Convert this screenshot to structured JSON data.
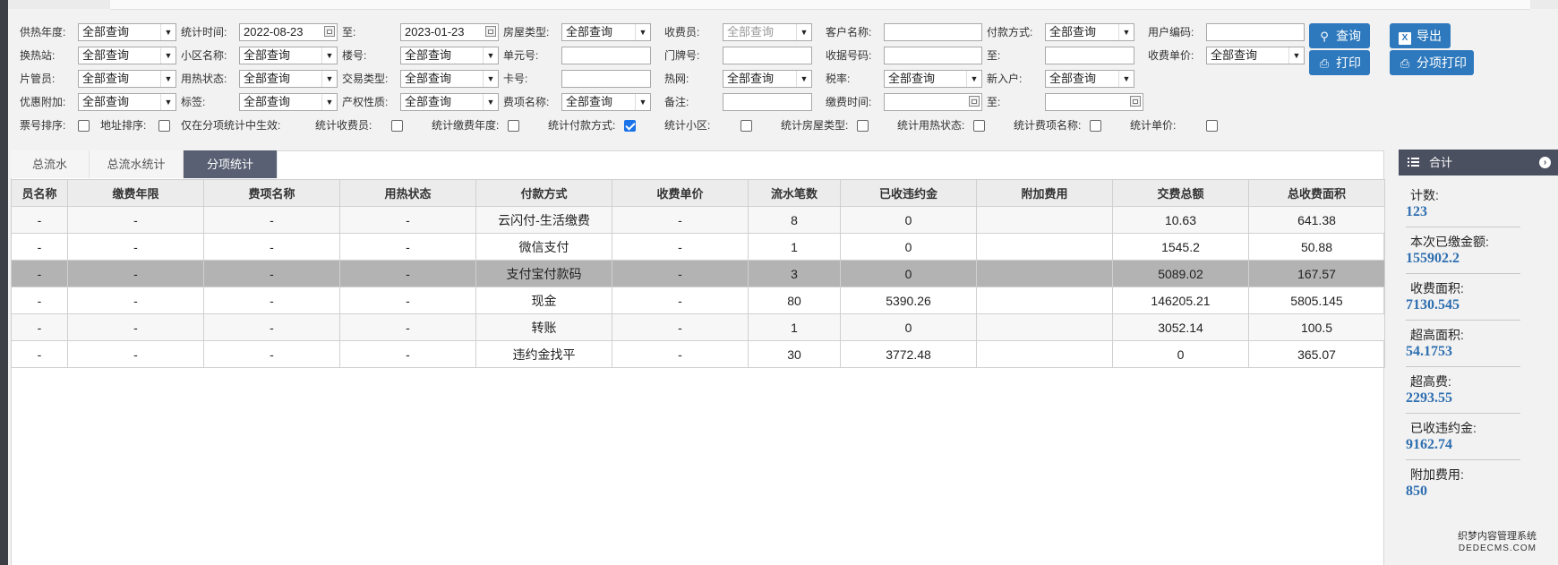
{
  "filters": {
    "row1": {
      "heating_year_label": "供热年度:",
      "heating_year_value": "全部查询",
      "stat_time_label": "统计时间:",
      "stat_time_from": "2022-08-23",
      "to_label": "至:",
      "stat_time_to": "2023-01-23",
      "house_type_label": "房屋类型:",
      "house_type_value": "全部查询",
      "collector_label": "收费员:",
      "collector_value": "全部查询",
      "customer_name_label": "客户名称:",
      "customer_name_value": "",
      "payment_method_label": "付款方式:",
      "payment_method_value": "全部查询",
      "user_code_label": "用户编码:",
      "user_code_value": ""
    },
    "row2": {
      "station_label": "换热站:",
      "station_value": "全部查询",
      "community_label": "小区名称:",
      "community_value": "全部查询",
      "building_label": "楼号:",
      "building_value": "全部查询",
      "unit_label": "单元号:",
      "unit_value": "",
      "door_label": "门牌号:",
      "door_value": "",
      "receipt_no_label": "收据号码:",
      "receipt_no_value": "",
      "to_label": "至:",
      "receipt_to_value": "",
      "unit_price_label": "收费单价:",
      "unit_price_value": "全部查询"
    },
    "row3": {
      "manager_label": "片管员:",
      "manager_value": "全部查询",
      "heat_status_label": "用热状态:",
      "heat_status_value": "全部查询",
      "trade_type_label": "交易类型:",
      "trade_type_value": "全部查询",
      "card_label": "卡号:",
      "card_value": "",
      "network_label": "热网:",
      "network_value": "全部查询",
      "tax_label": "税率:",
      "tax_value": "全部查询",
      "new_user_label": "新入户:",
      "new_user_value": "全部查询"
    },
    "row4": {
      "discount_label": "优惠附加:",
      "discount_value": "全部查询",
      "tag_label": "标签:",
      "tag_value": "全部查询",
      "property_label": "产权性质:",
      "property_value": "全部查询",
      "fee_name_label": "费项名称:",
      "fee_name_value": "全部查询",
      "remark_label": "备注:",
      "remark_value": "",
      "pay_time_label": "缴费时间:",
      "pay_time_from": "",
      "to_label": "至:",
      "pay_time_to": ""
    },
    "row5": {
      "ticket_sort_label": "票号排序:",
      "ticket_sort_checked": false,
      "address_sort_label": "地址排序:",
      "address_sort_checked": false,
      "sub_only_label": "仅在分项统计中生效:",
      "stat_collector_label": "统计收费员:",
      "stat_collector_checked": false,
      "stat_year_label": "统计缴费年度:",
      "stat_year_checked": false,
      "stat_payment_label": "统计付款方式:",
      "stat_payment_checked": true,
      "stat_community_label": "统计小区:",
      "stat_community_checked": false,
      "stat_house_type_label": "统计房屋类型:",
      "stat_house_type_checked": false,
      "stat_heat_status_label": "统计用热状态:",
      "stat_heat_status_checked": false,
      "stat_fee_name_label": "统计费项名称:",
      "stat_fee_name_checked": false,
      "stat_unit_price_label": "统计单价:",
      "stat_unit_price_checked": false
    }
  },
  "buttons": {
    "query": "查询",
    "export": "导出",
    "print": "打印",
    "sub_print": "分项打印"
  },
  "tabs": [
    "总流水",
    "总流水统计",
    "分项统计"
  ],
  "table": {
    "headers": [
      "员名称",
      "缴费年限",
      "费项名称",
      "用热状态",
      "付款方式",
      "收费单价",
      "流水笔数",
      "已收违约金",
      "附加费用",
      "交费总额",
      "总收费面积"
    ],
    "rows": [
      [
        "-",
        "-",
        "-",
        "-",
        "云闪付-生活缴费",
        "-",
        "8",
        "0",
        "",
        "10.63",
        "641.38"
      ],
      [
        "-",
        "-",
        "-",
        "-",
        "微信支付",
        "-",
        "1",
        "0",
        "",
        "1545.2",
        "50.88"
      ],
      [
        "-",
        "-",
        "-",
        "-",
        "支付宝付款码",
        "-",
        "3",
        "0",
        "",
        "5089.02",
        "167.57"
      ],
      [
        "-",
        "-",
        "-",
        "-",
        "现金",
        "-",
        "80",
        "5390.26",
        "",
        "146205.21",
        "5805.145"
      ],
      [
        "-",
        "-",
        "-",
        "-",
        "转账",
        "-",
        "1",
        "0",
        "",
        "3052.14",
        "100.5"
      ],
      [
        "-",
        "-",
        "-",
        "-",
        "违约金找平",
        "-",
        "30",
        "3772.48",
        "",
        "0",
        "365.07"
      ]
    ],
    "selected_row": 2
  },
  "summary": {
    "title": "合计",
    "items": [
      {
        "label": "计数:",
        "value": "123"
      },
      {
        "label": "本次已缴金额:",
        "value": "155902.2"
      },
      {
        "label": "收费面积:",
        "value": "7130.545"
      },
      {
        "label": "超高面积:",
        "value": "54.1753"
      },
      {
        "label": "超高费:",
        "value": "2293.55"
      },
      {
        "label": "已收违约金:",
        "value": "9162.74"
      },
      {
        "label": "附加费用:",
        "value": "850"
      }
    ]
  },
  "watermark": {
    "line1": "织梦内容管理系统",
    "line2": "DEDECMS.COM"
  }
}
